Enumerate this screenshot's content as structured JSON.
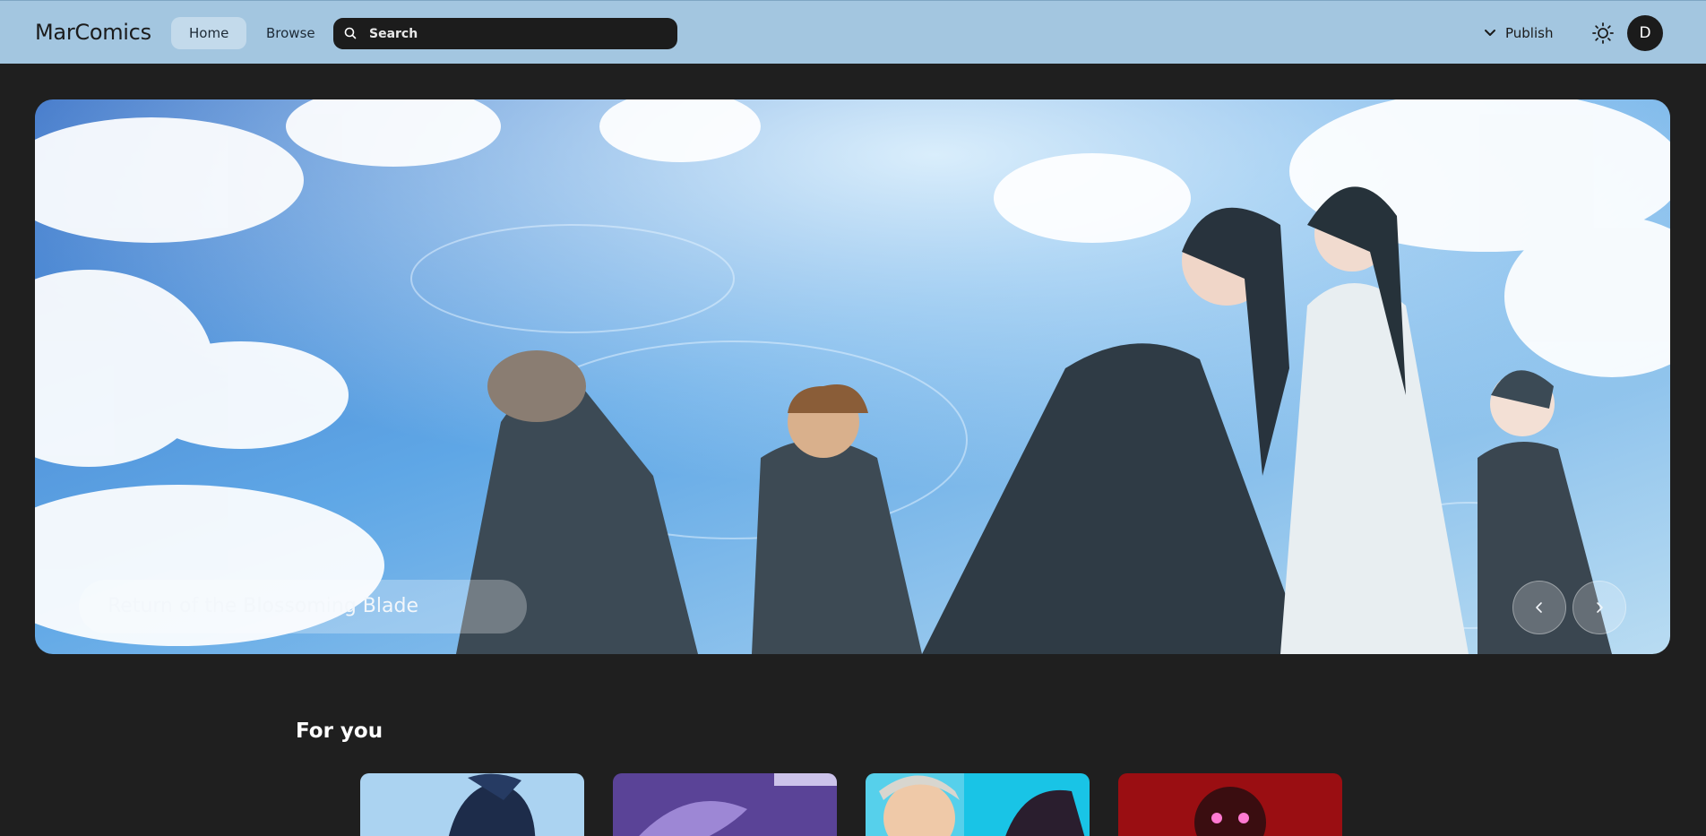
{
  "app": {
    "name": "MarComics"
  },
  "nav": {
    "home_label": "Home",
    "browse_label": "Browse"
  },
  "search": {
    "placeholder": "Search"
  },
  "header": {
    "publish_label": "Publish",
    "avatar_initial": "D"
  },
  "hero": {
    "title": "Return of the Blossoming Blade"
  },
  "sections": {
    "for_you_title": "For you"
  },
  "icons": {
    "search": "search-icon",
    "publish": "chevron-down-icon",
    "theme": "sun-icon",
    "prev": "chevron-left-icon",
    "next": "chevron-right-icon"
  },
  "colors": {
    "header_bg": "#a3c6e0",
    "page_bg": "#1f1f1f",
    "search_bg": "#1c1c1c",
    "active_nav_bg": "#c3daeb"
  }
}
